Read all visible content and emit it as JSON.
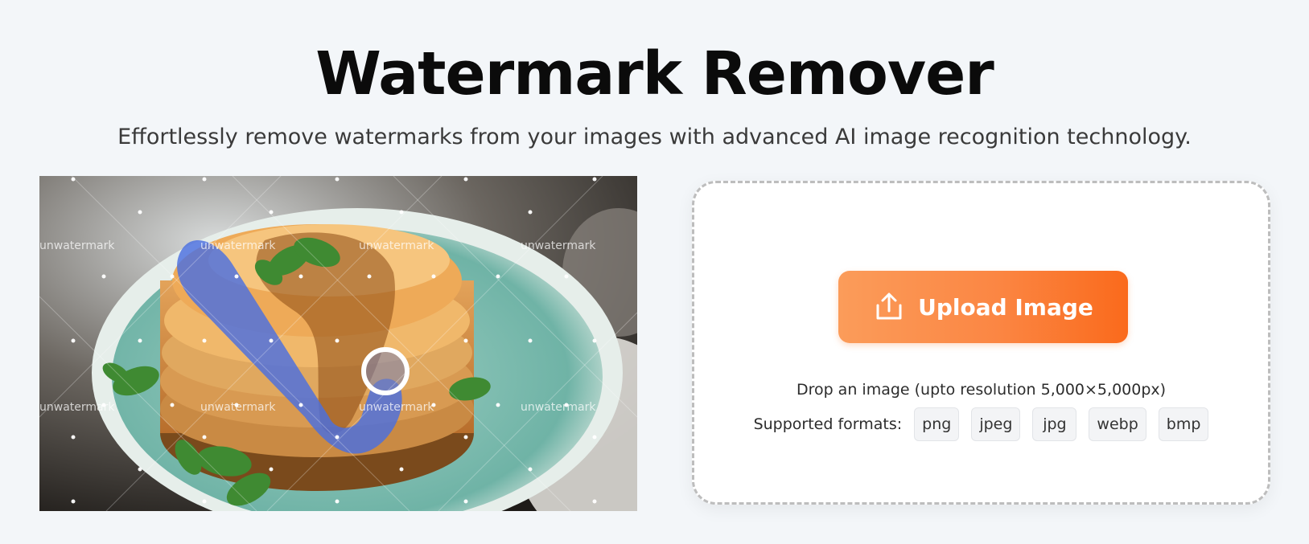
{
  "header": {
    "title": "Watermark Remover",
    "subtitle": "Effortlessly remove watermarks from your images with advanced AI image recognition technology."
  },
  "demo": {
    "watermark_text": "unwatermark"
  },
  "upload": {
    "button_label": "Upload Image",
    "drop_text": "Drop an image (upto resolution 5,000×5,000px)",
    "formats_label": "Supported formats:",
    "formats": [
      "png",
      "jpeg",
      "jpg",
      "webp",
      "bmp"
    ]
  },
  "colors": {
    "accent_start": "#fb9c5a",
    "accent_end": "#fa6a1c",
    "background": "#f3f6f9",
    "brush": "#4b6fe0"
  }
}
